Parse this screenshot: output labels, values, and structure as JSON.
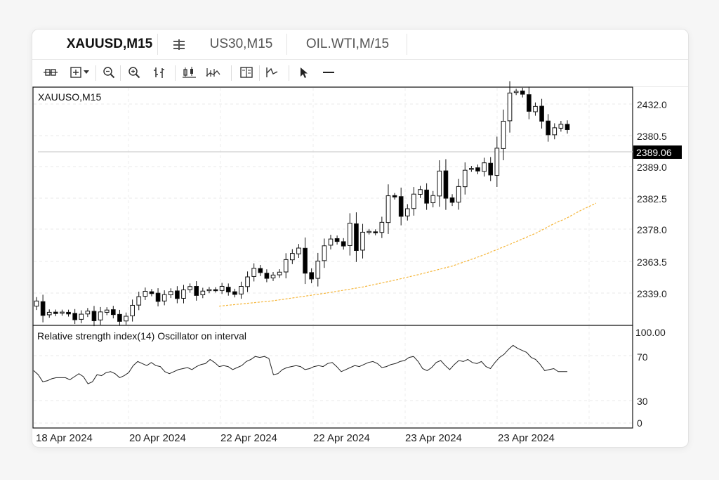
{
  "tabs": [
    {
      "label": "XAUUSD,M15",
      "active": true
    },
    {
      "label": "US30,M15",
      "active": false
    },
    {
      "label": "OIL.WTI,M/15",
      "active": false
    }
  ],
  "toolbar": {
    "icons": [
      "crosshair-icon",
      "add-indicator-icon",
      "dropdown-arrow-icon",
      "zoom-in-icon",
      "zoom-out-icon",
      "bar-chart-icon",
      "candlestick-icon",
      "line-chart-icon",
      "templates-icon",
      "indicators-icon",
      "cursor-icon",
      "horizontal-line-icon"
    ]
  },
  "colors": {
    "bull_fill": "#ffffff",
    "bear_fill": "#000000",
    "ma_line": "#f5b63a",
    "price_tag_bg": "#000000",
    "rsi_line": "#222222"
  },
  "price_panel": {
    "symbol_label": "XAUUSO,M15",
    "price_tag": "2389.06",
    "y_labels": [
      "2432.0",
      "2380.5",
      "2389.0",
      "2382.5",
      "2378.0",
      "2363.5",
      "2339.0"
    ]
  },
  "rsi_panel": {
    "label": "Relative strength index(14) Oscillator on interval",
    "y_labels": [
      "100.00",
      "70",
      "30",
      "0"
    ]
  },
  "x_labels": [
    "18 Apr 2024",
    "20 Apr 2024",
    "22 Apr 2024",
    "22 Apr 2024",
    "23 Apr 2024",
    "23 Apr 2024"
  ],
  "chart_data": {
    "type": "candlestick",
    "candles_open_close": [
      [
        2339.0,
        2341.5
      ],
      [
        2341.2,
        2334.5
      ],
      [
        2334.8,
        2336.0
      ],
      [
        2336.1,
        2335.4
      ],
      [
        2335.6,
        2336.1
      ],
      [
        2336.0,
        2335.2
      ],
      [
        2335.5,
        2332.4
      ],
      [
        2332.6,
        2335.1
      ],
      [
        2335.2,
        2336.6
      ],
      [
        2336.5,
        2331.9
      ],
      [
        2332.3,
        2336.2
      ],
      [
        2336.0,
        2337.1
      ],
      [
        2337.3,
        2334.9
      ],
      [
        2335.0,
        2331.6
      ],
      [
        2331.8,
        2334.1
      ],
      [
        2334.3,
        2339.4
      ],
      [
        2339.5,
        2343.6
      ],
      [
        2343.8,
        2346.2
      ],
      [
        2346.0,
        2345.1
      ],
      [
        2345.3,
        2341.3
      ],
      [
        2341.5,
        2344.6
      ],
      [
        2344.5,
        2346.1
      ],
      [
        2346.4,
        2342.7
      ],
      [
        2342.8,
        2346.9
      ],
      [
        2347.0,
        2348.5
      ],
      [
        2348.6,
        2344.2
      ],
      [
        2344.5,
        2346.3
      ],
      [
        2346.5,
        2347.1
      ],
      [
        2347.0,
        2346.8
      ],
      [
        2346.6,
        2348.6
      ],
      [
        2348.2,
        2345.9
      ],
      [
        2346.0,
        2344.7
      ],
      [
        2344.9,
        2348.6
      ],
      [
        2348.5,
        2353.2
      ],
      [
        2353.4,
        2357.4
      ],
      [
        2357.3,
        2355.3
      ],
      [
        2355.0,
        2352.5
      ],
      [
        2352.7,
        2354.1
      ],
      [
        2354.2,
        2355.5
      ],
      [
        2355.6,
        2361.6
      ],
      [
        2361.5,
        2364.6
      ],
      [
        2364.4,
        2367.2
      ],
      [
        2367.1,
        2355.0
      ],
      [
        2355.3,
        2352.2
      ],
      [
        2352.5,
        2360.9
      ],
      [
        2361.1,
        2368.3
      ],
      [
        2368.6,
        2371.6
      ],
      [
        2371.8,
        2370.4
      ],
      [
        2370.3,
        2368.2
      ],
      [
        2368.4,
        2379.3
      ],
      [
        2379.0,
        2366.0
      ],
      [
        2366.2,
        2374.9
      ],
      [
        2375.0,
        2375.3
      ],
      [
        2375.1,
        2374.6
      ],
      [
        2374.8,
        2379.7
      ],
      [
        2379.6,
        2392.6
      ],
      [
        2392.7,
        2392.0
      ],
      [
        2392.2,
        2382.6
      ],
      [
        2382.8,
        2386.3
      ],
      [
        2386.4,
        2393.4
      ],
      [
        2393.3,
        2395.6
      ],
      [
        2395.4,
        2389.0
      ],
      [
        2389.2,
        2392.7
      ],
      [
        2392.5,
        2404.6
      ],
      [
        2404.7,
        2391.4
      ],
      [
        2391.6,
        2389.4
      ],
      [
        2389.5,
        2397.1
      ],
      [
        2397.0,
        2405.0
      ],
      [
        2405.4,
        2405.9
      ],
      [
        2406.2,
        2404.6
      ],
      [
        2404.4,
        2408.6
      ],
      [
        2408.4,
        2402.7
      ],
      [
        2402.5,
        2415.7
      ],
      [
        2415.5,
        2428.8
      ],
      [
        2429.0,
        2442.5
      ],
      [
        2442.7,
        2443.3
      ],
      [
        2443.5,
        2441.9
      ],
      [
        2441.7,
        2433.6
      ],
      [
        2433.4,
        2436.0
      ],
      [
        2436.1,
        2428.8
      ],
      [
        2428.9,
        2422.2
      ],
      [
        2422.2,
        2425.6
      ],
      [
        2425.4,
        2427.3
      ],
      [
        2427.3,
        2424.7
      ]
    ],
    "moving_average": [
      [
        0.31,
        2339.0
      ],
      [
        0.4,
        2341.6
      ],
      [
        0.49,
        2345.4
      ],
      [
        0.55,
        2348.3
      ],
      [
        0.6,
        2351.4
      ],
      [
        0.64,
        2354.1
      ],
      [
        0.7,
        2358.5
      ],
      [
        0.75,
        2363.6
      ],
      [
        0.8,
        2369.5
      ],
      [
        0.84,
        2374.5
      ],
      [
        0.87,
        2379.1
      ],
      [
        0.89,
        2381.6
      ],
      [
        0.915,
        2385.6
      ],
      [
        0.94,
        2389.0
      ]
    ],
    "rsi": [
      56,
      52,
      45,
      46,
      48,
      49,
      49,
      49,
      47,
      50,
      53,
      50,
      43,
      45,
      52,
      51,
      54,
      55,
      53,
      49,
      51,
      54,
      61,
      65,
      63,
      61,
      64,
      61,
      60,
      55,
      53,
      55,
      57,
      58,
      59,
      57,
      60,
      62,
      63,
      67,
      64,
      60,
      61,
      60,
      57,
      59,
      61,
      65,
      67,
      70,
      69,
      70,
      68,
      52,
      53,
      57,
      59,
      60,
      61,
      60,
      57,
      58,
      60,
      61,
      60,
      63,
      64,
      60,
      55,
      57,
      59,
      61,
      60,
      62,
      64,
      65,
      63,
      59,
      60,
      62,
      63,
      65,
      66,
      69,
      70,
      65,
      58,
      56,
      59,
      64,
      66,
      61,
      57,
      62,
      66,
      65,
      67,
      64,
      63,
      65,
      60,
      58,
      64,
      69,
      72,
      77,
      81,
      78,
      76,
      74,
      69,
      67,
      62,
      56,
      57,
      58,
      55,
      55,
      55
    ],
    "price_range": [
      2330,
      2445
    ],
    "rsi_range": [
      0,
      100
    ]
  }
}
